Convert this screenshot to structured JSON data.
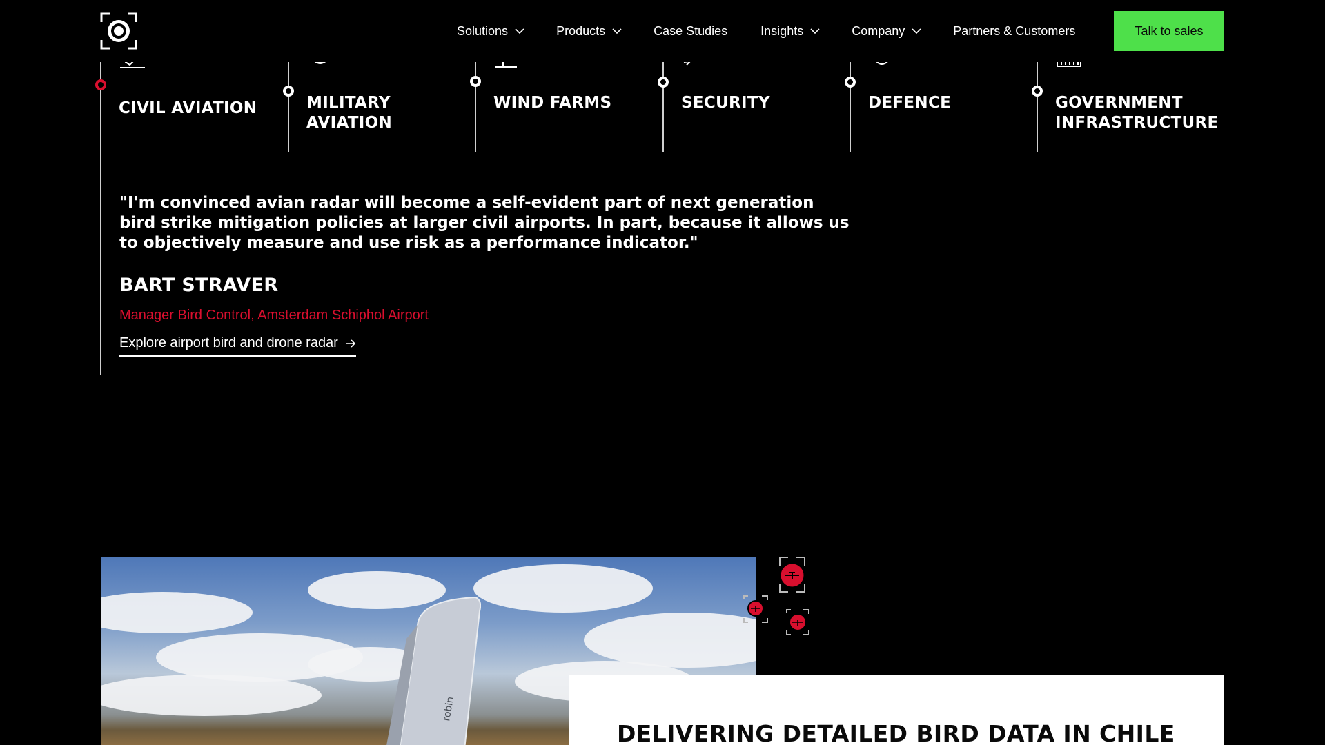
{
  "nav": {
    "items": [
      {
        "label": "Solutions",
        "has_dropdown": true
      },
      {
        "label": "Products",
        "has_dropdown": true
      },
      {
        "label": "Case Studies",
        "has_dropdown": false
      },
      {
        "label": "Insights",
        "has_dropdown": true
      },
      {
        "label": "Company",
        "has_dropdown": true
      },
      {
        "label": "Partners & Customers",
        "has_dropdown": false
      }
    ],
    "cta_label": "Talk to sales"
  },
  "sectors": [
    {
      "label": "CIVIL AVIATION",
      "icon": "plane-takeoff-icon",
      "active": true
    },
    {
      "label": "MILITARY AVIATION",
      "icon": "military-emblem-icon",
      "active": false
    },
    {
      "label": "WIND FARMS",
      "icon": "wind-turbine-icon",
      "active": false
    },
    {
      "label": "SECURITY",
      "icon": "drone-icon",
      "active": false
    },
    {
      "label": "DEFENCE",
      "icon": "radar-dish-icon",
      "active": false
    },
    {
      "label": "GOVERNMENT INFRASTRUCTURE",
      "icon": "building-icon",
      "active": false
    }
  ],
  "testimonial": {
    "quote": "\"I'm convinced avian radar will become a self-evident part of next generation bird strike mitigation policies at larger civil airports. In part, because it allows us to objectively measure and use risk as a performance indicator.\"",
    "name": "BART STRAVER",
    "role": "Manager Bird Control, Amsterdam Schiphol Airport",
    "link_label": "Explore airport bird and drone radar"
  },
  "case_card": {
    "title": "DELIVERING DETAILED BIRD DATA IN CHILE"
  },
  "colors": {
    "accent_red": "#d80f2e",
    "cta_green": "#4ee04a",
    "background": "#000000"
  }
}
